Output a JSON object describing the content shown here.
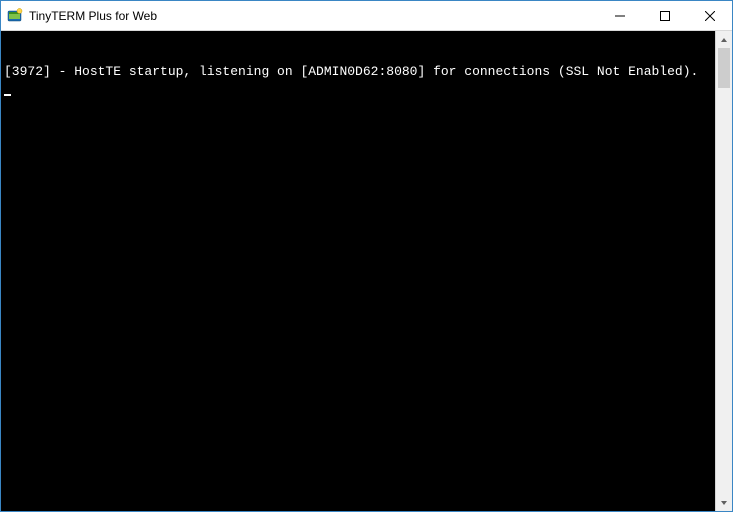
{
  "window": {
    "title": "TinyTERM Plus for Web"
  },
  "terminal": {
    "line1": "[3972] - HostTE startup, listening on [ADMIN0D62:8080] for connections (SSL Not Enabled)."
  }
}
